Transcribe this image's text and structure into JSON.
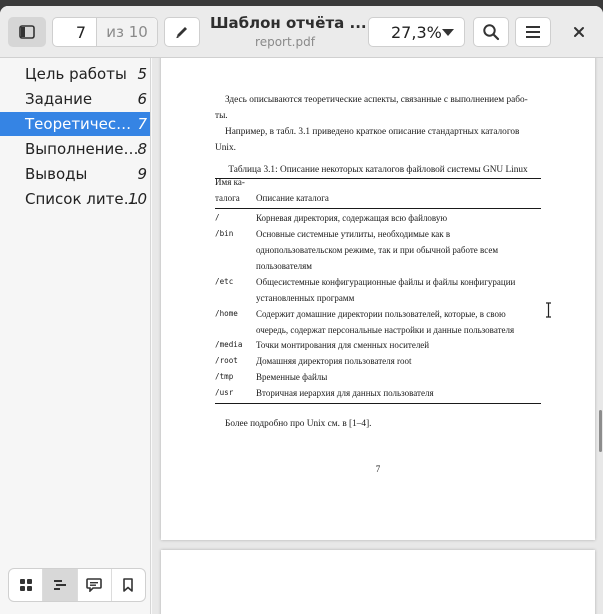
{
  "window": {
    "title": "Шаблон отчёта ...",
    "subtitle": "report.pdf"
  },
  "toolbar": {
    "sidebar_toggle": "sidebar-toggle-icon",
    "current_page": "7",
    "total_pages": "из 10",
    "annotate_icon": "pencil-icon",
    "zoom": "27,3%",
    "search_icon": "search-icon",
    "menu_icon": "hamburger-menu-icon",
    "close_icon": "close-icon"
  },
  "sidebar": {
    "items": [
      {
        "label": "Цель работы",
        "page": "5",
        "selected": false
      },
      {
        "label": "Задание",
        "page": "6",
        "selected": false
      },
      {
        "label": "Теоретичес…",
        "page": "7",
        "selected": true
      },
      {
        "label": "Выполнение…",
        "page": "8",
        "selected": false
      },
      {
        "label": "Выводы",
        "page": "9",
        "selected": false
      },
      {
        "label": "Список лите…",
        "page": "10",
        "selected": false
      }
    ],
    "bottom_tabs": [
      "thumbnails-icon",
      "outline-icon",
      "annotations-icon",
      "bookmarks-icon"
    ]
  },
  "document": {
    "para1_line1": "Здесь описываются теоретические аспекты, связанные с выполнением рабо-",
    "para1_line2": "ты.",
    "para2_line1": "Например, в табл. 3.1 приведено краткое описание стандартных каталогов",
    "para2_line2": "Unix.",
    "table_caption": "Таблица 3.1: Описание некоторых каталогов файловой системы GNU Linux",
    "table_header": {
      "col1_line1": "Имя ка-",
      "col1_line2": "талога",
      "col2": "Описание каталога"
    },
    "rows": [
      {
        "dir": "/",
        "lines": [
          "Корневая директория, содержащая всю файловую"
        ]
      },
      {
        "dir": "/bin",
        "lines": [
          "Основные системные утилиты, необходимые как в",
          "однопользовательском режиме, так и при обычной работе всем",
          "пользователям"
        ]
      },
      {
        "dir": "/etc",
        "lines": [
          "Общесистемные конфигурационные файлы и файлы конфигурации",
          "установленных программ"
        ]
      },
      {
        "dir": "/home",
        "lines": [
          "Содержит домашние директории пользователей, которые, в свою",
          "очередь, содержат персональные настройки и данные пользователя"
        ]
      },
      {
        "dir": "/media",
        "lines": [
          "Точки монтирования для сменных носителей"
        ]
      },
      {
        "dir": "/root",
        "lines": [
          "Домашняя директория пользователя root"
        ]
      },
      {
        "dir": "/tmp",
        "lines": [
          "Временные файлы"
        ]
      },
      {
        "dir": "/usr",
        "lines": [
          "Вторичная иерархия для данных пользователя"
        ]
      }
    ],
    "footer_text": "Более подробно про Unix см. в [1–4].",
    "page_number": "7"
  },
  "colors": {
    "accent": "#3584e4",
    "header_bg": "#ebebeb",
    "viewer_bg": "#e8e8e8"
  }
}
